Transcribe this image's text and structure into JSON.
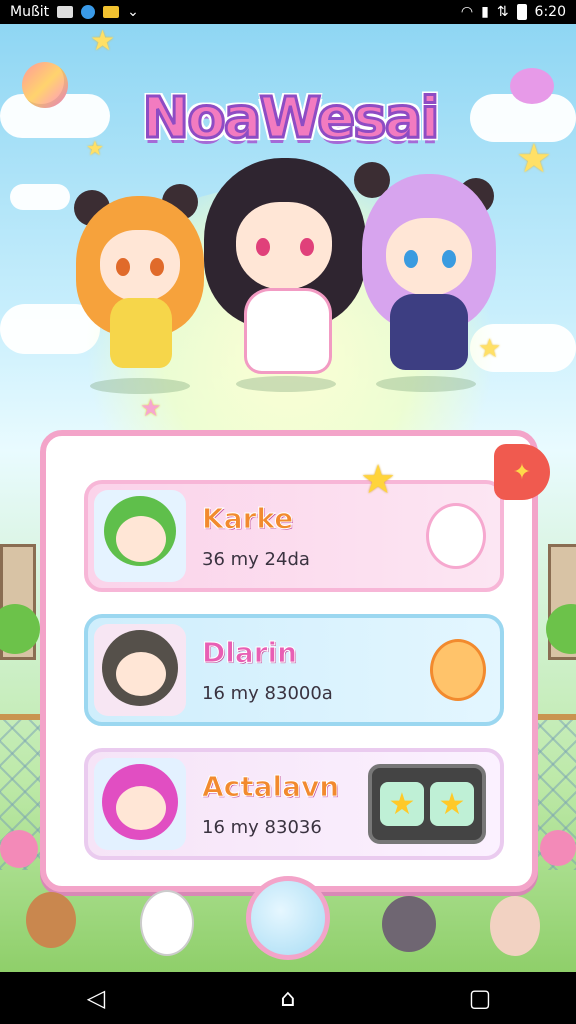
{
  "status_bar": {
    "carrier": "Mußit",
    "time": "6:20"
  },
  "game": {
    "logo": "NoaWesai",
    "players": [
      {
        "name": "Karke",
        "stat": "36 my 24da",
        "theme": "pink"
      },
      {
        "name": "Dlarin",
        "stat": "16 my 83000a",
        "theme": "blue"
      },
      {
        "name": "Actalavn",
        "stat": "16 my 83036",
        "theme": "lav"
      }
    ]
  },
  "nav": {
    "back": "◁",
    "home": "⌂",
    "recents": "▢"
  },
  "colors": {
    "panel_border": "#f3a4c9",
    "name_orange": "#f28a2e",
    "logo_pink": "#f27bc0"
  }
}
